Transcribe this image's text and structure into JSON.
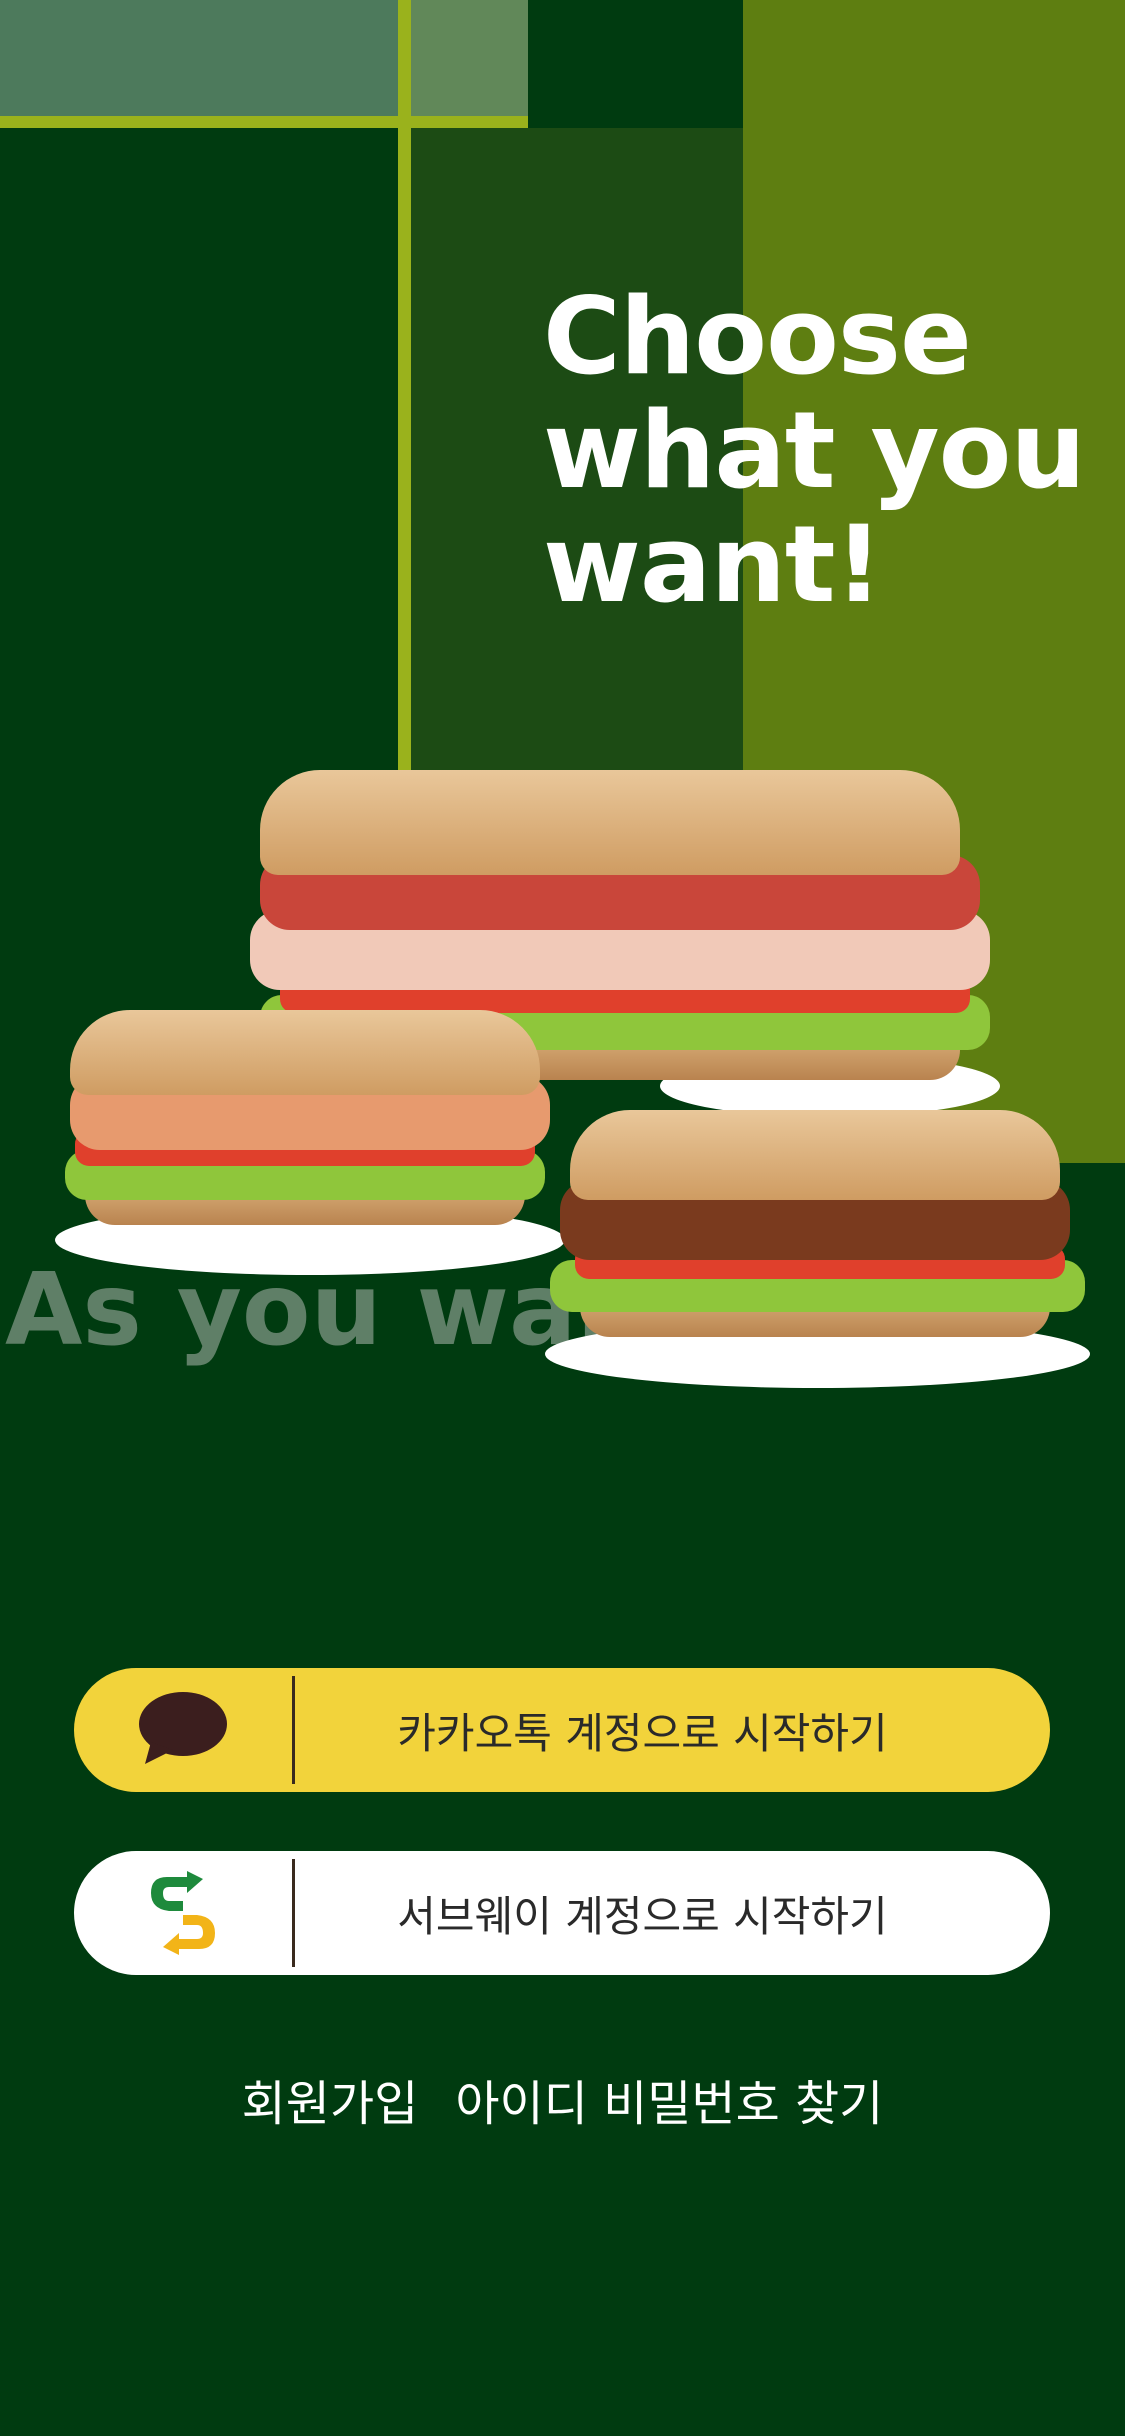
{
  "headline": {
    "line1": "Choose",
    "line2": "what you",
    "line3": "want!"
  },
  "ghost_text": "As you want",
  "sandwiches": [
    {
      "name": "ham-salami-pepperoni",
      "meat_color": "#c9463a"
    },
    {
      "name": "turkey",
      "meat_color": "#e79a6e"
    },
    {
      "name": "pulled-pork",
      "meat_color": "#7a3a1e"
    }
  ],
  "login": {
    "kakao": {
      "label": "카카오톡 계정으로 시작하기",
      "icon": "kakao-talk-bubble-icon",
      "bg": "#f2d33b"
    },
    "subway": {
      "label": "서브웨이 계정으로 시작하기",
      "icon": "subway-logo-icon",
      "bg": "#ffffff"
    }
  },
  "links": {
    "signup": "회원가입",
    "find_account": "아이디 비밀번호 찾기"
  },
  "colors": {
    "background": "#003b10",
    "accent_green": "#5e7e11",
    "accent_line": "#9ab21c",
    "white": "#ffffff"
  }
}
